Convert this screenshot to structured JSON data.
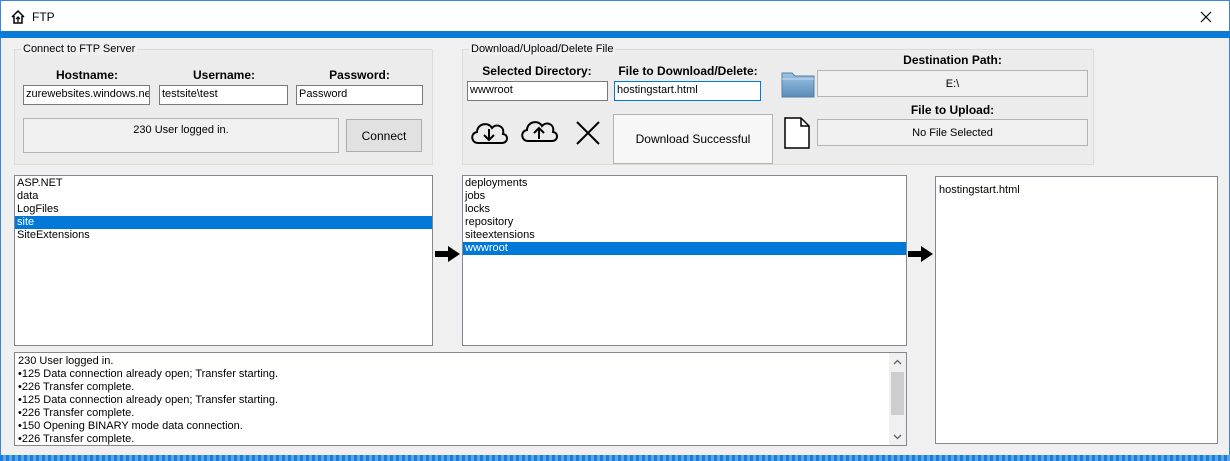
{
  "window": {
    "title": "FTP"
  },
  "connect": {
    "legend": "Connect to FTP Server",
    "hostname_label": "Hostname:",
    "username_label": "Username:",
    "password_label": "Password:",
    "hostname_value": "zurewebsites.windows.net",
    "username_value": "testsite\\test",
    "password_value": "Password",
    "status": "230 User logged in.",
    "connect_button": "Connect"
  },
  "transfer": {
    "legend": "Download/Upload/Delete File",
    "selected_dir_label": "Selected Directory:",
    "file_label": "File to Download/Delete:",
    "selected_dir_value": "wwwroot",
    "file_value": "hostingstart.html",
    "status": "Download Successful",
    "dest_path_label": "Destination Path:",
    "dest_path_value": "E:\\",
    "upload_label": "File to Upload:",
    "upload_value": "No File Selected"
  },
  "lists": {
    "left": {
      "items": [
        "ASP.NET",
        "data",
        "LogFiles",
        "site",
        "SiteExtensions"
      ],
      "selected": "site"
    },
    "middle": {
      "items": [
        "deployments",
        "jobs",
        "locks",
        "repository",
        "siteextensions",
        "wwwroot"
      ],
      "selected": "wwwroot"
    },
    "right": {
      "items": [
        "hostingstart.html"
      ]
    }
  },
  "log": {
    "lines": [
      "230 User logged in.",
      "•125 Data connection already open; Transfer starting.",
      "•226 Transfer complete.",
      "•125 Data connection already open; Transfer starting.",
      "•226 Transfer complete.",
      "•150 Opening BINARY mode data connection.",
      "•226 Transfer complete."
    ]
  },
  "colors": {
    "accent": "#0a7bd7",
    "selection": "#0078d7"
  },
  "icons": {
    "app": "home-upload-icon",
    "close": "close-icon",
    "download": "cloud-download-icon",
    "upload": "cloud-upload-icon",
    "delete": "x-delete-icon",
    "folder": "folder-icon",
    "file": "file-icon",
    "arrow": "arrow-right-icon"
  }
}
